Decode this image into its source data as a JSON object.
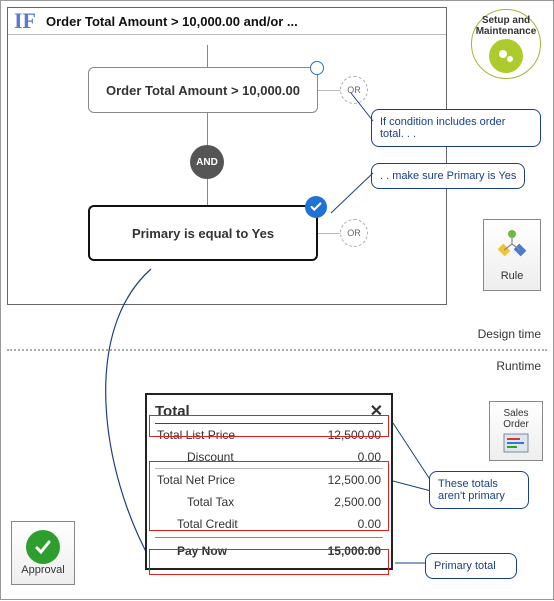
{
  "setup_label": "Setup and Maintenance",
  "rule_box_label": "Rule",
  "if_keyword": "IF",
  "if_summary": "Order Total Amount > 10,000.00 and/or ...",
  "cond1": "Order Total Amount > 10,000.00",
  "and_label": "AND",
  "cond2": "Primary is equal to Yes",
  "or_label": "OR",
  "callout_cond1": "If condition includes order total. . .",
  "callout_cond2": ". . make sure Primary is Yes",
  "phase_design": "Design time",
  "phase_runtime": "Runtime",
  "totals": {
    "header": "Total",
    "close": "✕",
    "rows": {
      "list_price_l": "Total List Price",
      "list_price_v": "12,500.00",
      "discount_l": "Discount",
      "discount_v": "0.00",
      "net_price_l": "Total Net Price",
      "net_price_v": "12,500.00",
      "tax_l": "Total Tax",
      "tax_v": "2,500.00",
      "credit_l": "Total Credit",
      "credit_v": "0.00",
      "pay_l": "Pay Now",
      "pay_v": "15,000.00"
    }
  },
  "callout_notprimary": "These totals aren't primary",
  "callout_primary": "Primary total",
  "sales_order_label": "Sales Order",
  "approval_label": "Approval"
}
